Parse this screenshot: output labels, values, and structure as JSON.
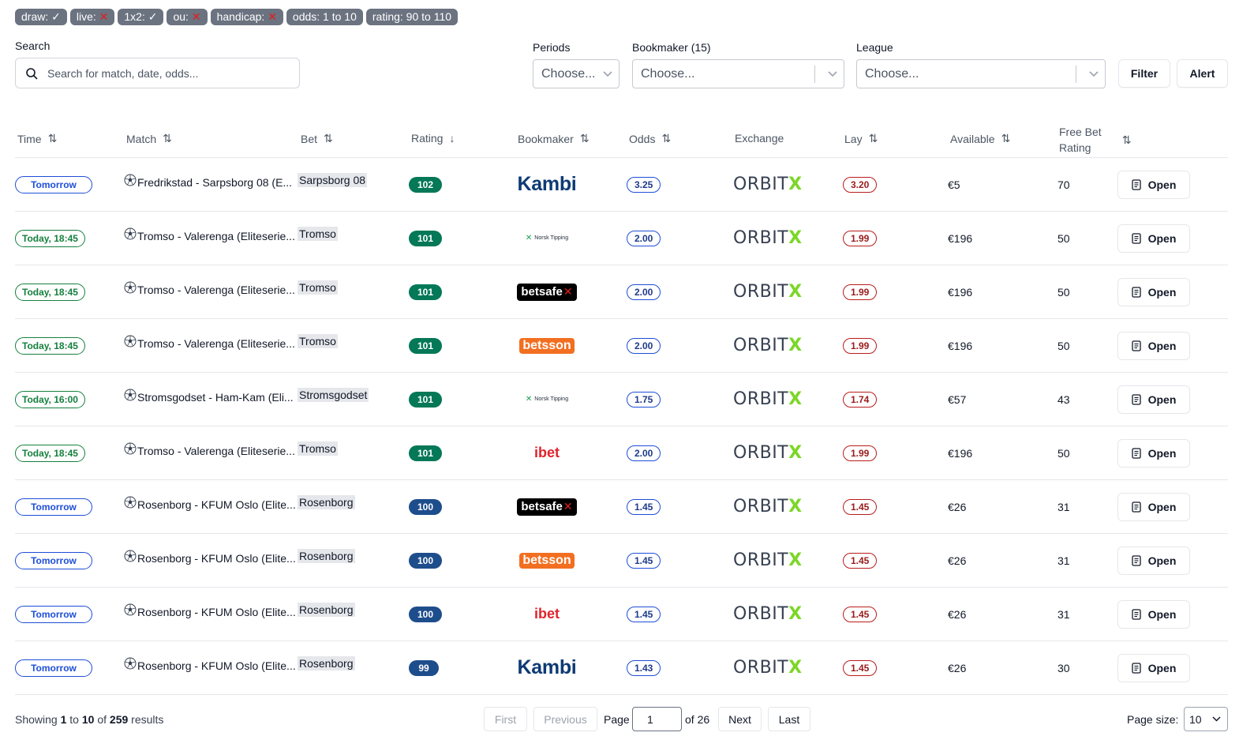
{
  "tags": [
    {
      "label": "draw:",
      "mark": "✓",
      "mark_type": "check"
    },
    {
      "label": "live:",
      "mark": "✕",
      "mark_type": "cross"
    },
    {
      "label": "1x2:",
      "mark": "✓",
      "mark_type": "check"
    },
    {
      "label": "ou:",
      "mark": "✕",
      "mark_type": "cross"
    },
    {
      "label": "handicap:",
      "mark": "✕",
      "mark_type": "cross"
    },
    {
      "label": "odds: 1 to 10",
      "mark": "",
      "mark_type": "none"
    },
    {
      "label": "rating: 90 to 110",
      "mark": "",
      "mark_type": "none"
    }
  ],
  "search": {
    "label": "Search",
    "placeholder": "Search for match, date, odds..."
  },
  "filters": {
    "periods": {
      "label": "Periods",
      "placeholder": "Choose..."
    },
    "bookmaker": {
      "label": "Bookmaker (15)",
      "placeholder": "Choose..."
    },
    "league": {
      "label": "League",
      "placeholder": "Choose..."
    },
    "filter_button": "Filter",
    "alert_button": "Alert"
  },
  "columns": {
    "time": "Time",
    "match": "Match",
    "bet": "Bet",
    "rating": "Rating",
    "bookmaker": "Bookmaker",
    "odds": "Odds",
    "exchange": "Exchange",
    "lay": "Lay",
    "available": "Available",
    "free_bet_rating_1": "Free Bet",
    "free_bet_rating_2": "Rating"
  },
  "rows": [
    {
      "time": "Tomorrow",
      "time_style": "blue",
      "match": "Fredrikstad - Sarpsborg 08 (E...",
      "bet": "Sarpsborg 08",
      "rating": "102",
      "rating_color": "#047857",
      "bookmaker": "Kambi",
      "bookmaker_logo": "kambi",
      "odds": "3.25",
      "exchange": "ORBITX",
      "lay": "3.20",
      "available": "€5",
      "free_bet_rating": "70",
      "action": "Open"
    },
    {
      "time": "Today, 18:45",
      "time_style": "green",
      "match": "Tromso - Valerenga (Eliteserie...",
      "bet": "Tromso",
      "rating": "101",
      "rating_color": "#047857",
      "bookmaker": "Norsk Tipping",
      "bookmaker_logo": "norsk",
      "odds": "2.00",
      "exchange": "ORBITX",
      "lay": "1.99",
      "available": "€196",
      "free_bet_rating": "50",
      "action": "Open"
    },
    {
      "time": "Today, 18:45",
      "time_style": "green",
      "match": "Tromso - Valerenga (Eliteserie...",
      "bet": "Tromso",
      "rating": "101",
      "rating_color": "#047857",
      "bookmaker": "betsafe",
      "bookmaker_logo": "betsafe",
      "odds": "2.00",
      "exchange": "ORBITX",
      "lay": "1.99",
      "available": "€196",
      "free_bet_rating": "50",
      "action": "Open"
    },
    {
      "time": "Today, 18:45",
      "time_style": "green",
      "match": "Tromso - Valerenga (Eliteserie...",
      "bet": "Tromso",
      "rating": "101",
      "rating_color": "#047857",
      "bookmaker": "betsson",
      "bookmaker_logo": "betsson",
      "odds": "2.00",
      "exchange": "ORBITX",
      "lay": "1.99",
      "available": "€196",
      "free_bet_rating": "50",
      "action": "Open"
    },
    {
      "time": "Today, 16:00",
      "time_style": "green",
      "match": "Stromsgodset - Ham-Kam (Eli...",
      "bet": "Stromsgodset",
      "rating": "101",
      "rating_color": "#047857",
      "bookmaker": "Norsk Tipping",
      "bookmaker_logo": "norsk",
      "odds": "1.75",
      "exchange": "ORBITX",
      "lay": "1.74",
      "available": "€57",
      "free_bet_rating": "43",
      "action": "Open"
    },
    {
      "time": "Today, 18:45",
      "time_style": "green",
      "match": "Tromso - Valerenga (Eliteserie...",
      "bet": "Tromso",
      "rating": "101",
      "rating_color": "#047857",
      "bookmaker": "ibet",
      "bookmaker_logo": "ibet",
      "odds": "2.00",
      "exchange": "ORBITX",
      "lay": "1.99",
      "available": "€196",
      "free_bet_rating": "50",
      "action": "Open"
    },
    {
      "time": "Tomorrow",
      "time_style": "blue",
      "match": "Rosenborg - KFUM Oslo (Elite...",
      "bet": "Rosenborg",
      "rating": "100",
      "rating_color": "#1e4d8c",
      "bookmaker": "betsafe",
      "bookmaker_logo": "betsafe",
      "odds": "1.45",
      "exchange": "ORBITX",
      "lay": "1.45",
      "available": "€26",
      "free_bet_rating": "31",
      "action": "Open"
    },
    {
      "time": "Tomorrow",
      "time_style": "blue",
      "match": "Rosenborg - KFUM Oslo (Elite...",
      "bet": "Rosenborg",
      "rating": "100",
      "rating_color": "#1e4d8c",
      "bookmaker": "betsson",
      "bookmaker_logo": "betsson",
      "odds": "1.45",
      "exchange": "ORBITX",
      "lay": "1.45",
      "available": "€26",
      "free_bet_rating": "31",
      "action": "Open"
    },
    {
      "time": "Tomorrow",
      "time_style": "blue",
      "match": "Rosenborg - KFUM Oslo (Elite...",
      "bet": "Rosenborg",
      "rating": "100",
      "rating_color": "#1e4d8c",
      "bookmaker": "ibet",
      "bookmaker_logo": "ibet",
      "odds": "1.45",
      "exchange": "ORBITX",
      "lay": "1.45",
      "available": "€26",
      "free_bet_rating": "31",
      "action": "Open"
    },
    {
      "time": "Tomorrow",
      "time_style": "blue",
      "match": "Rosenborg - KFUM Oslo (Elite...",
      "bet": "Rosenborg",
      "rating": "99",
      "rating_color": "#1e4d8c",
      "bookmaker": "Kambi",
      "bookmaker_logo": "kambi",
      "odds": "1.43",
      "exchange": "ORBITX",
      "lay": "1.45",
      "available": "€26",
      "free_bet_rating": "30",
      "action": "Open"
    }
  ],
  "footer": {
    "showing_prefix": "Showing",
    "from": "1",
    "to_word": "to",
    "to": "10",
    "of_word": "of",
    "total": "259",
    "results_word": "results",
    "first": "First",
    "previous": "Previous",
    "page_label": "Page",
    "page_value": "1",
    "of_pages": "of 26",
    "next": "Next",
    "last": "Last",
    "page_size_label": "Page size:",
    "page_size_value": "10"
  },
  "icons": {
    "search": "search-icon",
    "chevron": "chevron-down-icon",
    "sort": "sort-icon",
    "sort_desc": "arrow-down-icon",
    "soccer": "soccer-ball-icon",
    "open": "document-icon"
  },
  "colors": {
    "tag_bg": "#6b7280",
    "time_blue": "#1d4ed8",
    "time_green": "#15803d",
    "rating_green": "#047857",
    "rating_blue": "#1e4d8c",
    "odds_blue": "#1d4ed8",
    "lay_red": "#b91c1c",
    "orbitx_green": "#7cd627"
  }
}
